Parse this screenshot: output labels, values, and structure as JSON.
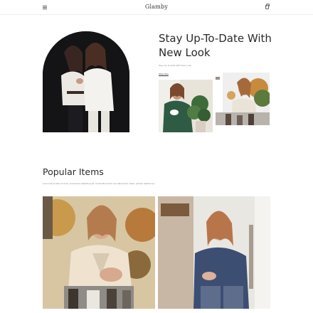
{
  "header": {
    "logo": "Glamby",
    "menu_icon": "menu-icon",
    "cart_icon": "shopping-bag-icon"
  },
  "hero": {
    "title": "Stay Up-To-Date With New Look",
    "subtitle": "Stay Up-To-Date With New Look",
    "link": "Shop Now"
  },
  "popular": {
    "title": "Popular Items",
    "description": "Lorem ipsum dolor sit amet, consectetur adipiscing elit. Ut elit tellus luctus nec ullamcorper mattis, pulvinar dapibus leo."
  },
  "colors": {
    "text": "#2a2a2a",
    "muted": "#8a8a8a",
    "divider": "#eeeeee",
    "hero_background": "#17171a"
  }
}
